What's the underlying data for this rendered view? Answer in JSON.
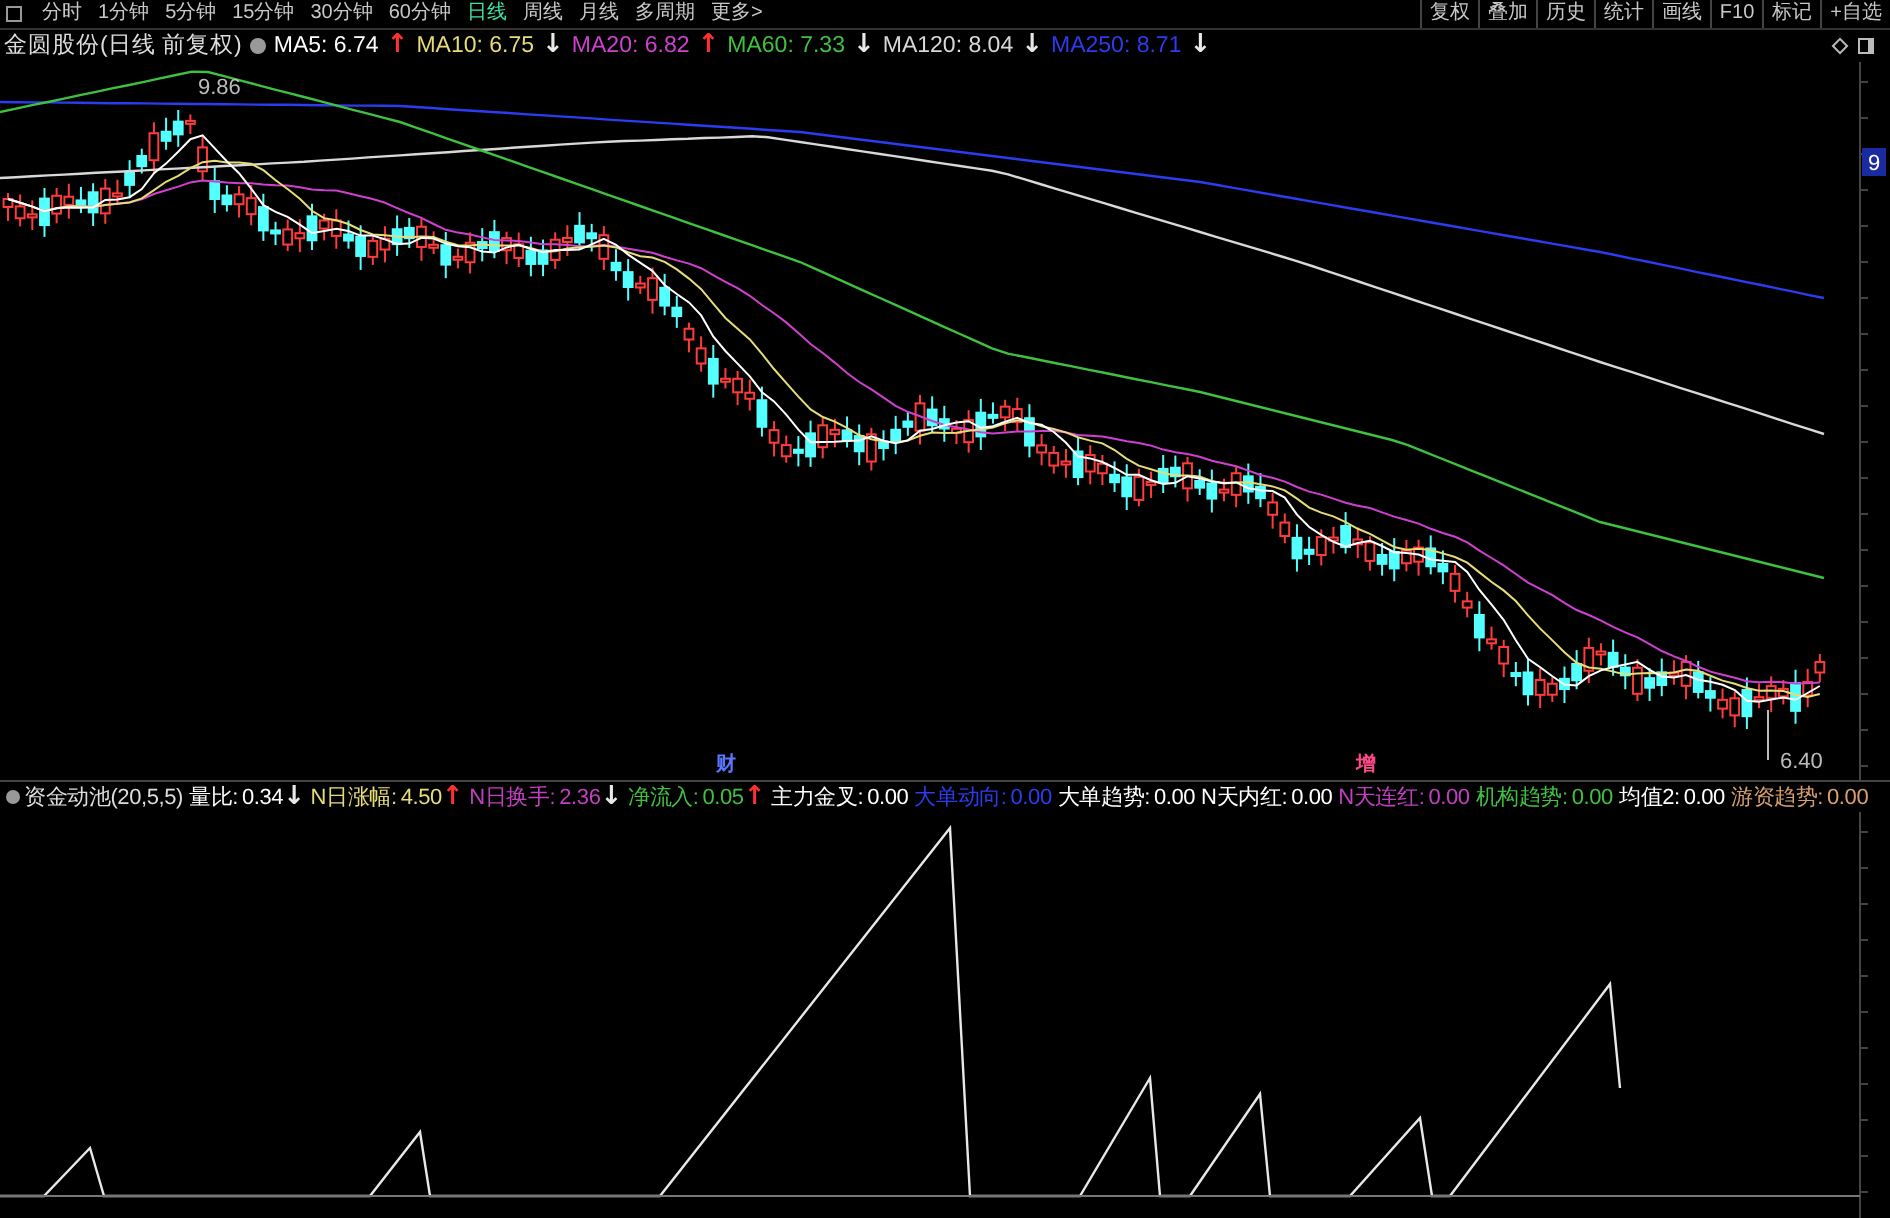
{
  "toolbar": {
    "period_tabs": [
      {
        "label": "分时",
        "selected": false
      },
      {
        "label": "1分钟",
        "selected": false
      },
      {
        "label": "5分钟",
        "selected": false
      },
      {
        "label": "15分钟",
        "selected": false
      },
      {
        "label": "30分钟",
        "selected": false
      },
      {
        "label": "60分钟",
        "selected": false
      },
      {
        "label": "日线",
        "selected": true
      },
      {
        "label": "周线",
        "selected": false
      },
      {
        "label": "月线",
        "selected": false
      },
      {
        "label": "多周期",
        "selected": false
      },
      {
        "label": "更多>",
        "selected": false
      }
    ],
    "tools": [
      "复权",
      "叠加",
      "历史",
      "统计",
      "画线",
      "F10",
      "标记",
      "+自选"
    ]
  },
  "price_panel": {
    "title": "金圆股份(日线 前复权)",
    "moving_averages": [
      {
        "label": "MA5: 6.74",
        "arrow": {
          "symbol": "↑",
          "color": "#ff3030"
        },
        "color": "#ffffff"
      },
      {
        "label": "MA10: 6.75",
        "arrow": {
          "symbol": "↓",
          "color": "#e8e8e8"
        },
        "color": "#e6dc78"
      },
      {
        "label": "MA20: 6.82",
        "arrow": {
          "symbol": "↑",
          "color": "#ff3030"
        },
        "color": "#d040d0"
      },
      {
        "label": "MA60: 7.33",
        "arrow": {
          "symbol": "↓",
          "color": "#e8e8e8"
        },
        "color": "#40c040"
      },
      {
        "label": "MA120: 8.04",
        "arrow": {
          "symbol": "↓",
          "color": "#e8e8e8"
        },
        "color": "#d8d8d8"
      },
      {
        "label": "MA250: 8.71",
        "arrow": {
          "symbol": "↓",
          "color": "#e8e8e8"
        },
        "color": "#2c3cf0"
      }
    ],
    "high_label": "9.86",
    "low_label": "6.40",
    "axis_label": "9",
    "event_marks": [
      {
        "label": "财",
        "color": "#5a78ff"
      },
      {
        "label": "增",
        "color": "#ff4a8a"
      }
    ]
  },
  "indicator_panel": {
    "title": "资金动池(20,5,5)",
    "fields": [
      {
        "label": "量比:",
        "value": "0.34",
        "arrow": {
          "symbol": "↓",
          "color": "#e8e8e8"
        },
        "color": "#ffffff"
      },
      {
        "label": "N日涨幅:",
        "value": "4.50",
        "arrow": {
          "symbol": "↑",
          "color": "#ff3030"
        },
        "color": "#e6dc78"
      },
      {
        "label": "N日换手:",
        "value": "2.36",
        "arrow": {
          "symbol": "↓",
          "color": "#e8e8e8"
        },
        "color": "#c040c0"
      },
      {
        "label": "净流入:",
        "value": "0.05",
        "arrow": {
          "symbol": "↑",
          "color": "#ff3030"
        },
        "color": "#40c040"
      },
      {
        "label": "主力金叉:",
        "value": "0.00",
        "color": "#ffffff"
      },
      {
        "label": "大单动向:",
        "value": "0.00",
        "color": "#2c3cf0"
      },
      {
        "label": "大单趋势:",
        "value": "0.00",
        "color": "#ffffff"
      },
      {
        "label": "N天内红:",
        "value": "0.00",
        "color": "#ffffff"
      },
      {
        "label": "N天连红:",
        "value": "0.00",
        "color": "#c040c0"
      },
      {
        "label": "机构趋势:",
        "value": "0.00",
        "color": "#40c040"
      },
      {
        "label": "均值2:",
        "value": "0.00",
        "color": "#ffffff"
      },
      {
        "label": "游资趋势:",
        "value": "0.00",
        "color": "#d8a070"
      }
    ]
  }
}
